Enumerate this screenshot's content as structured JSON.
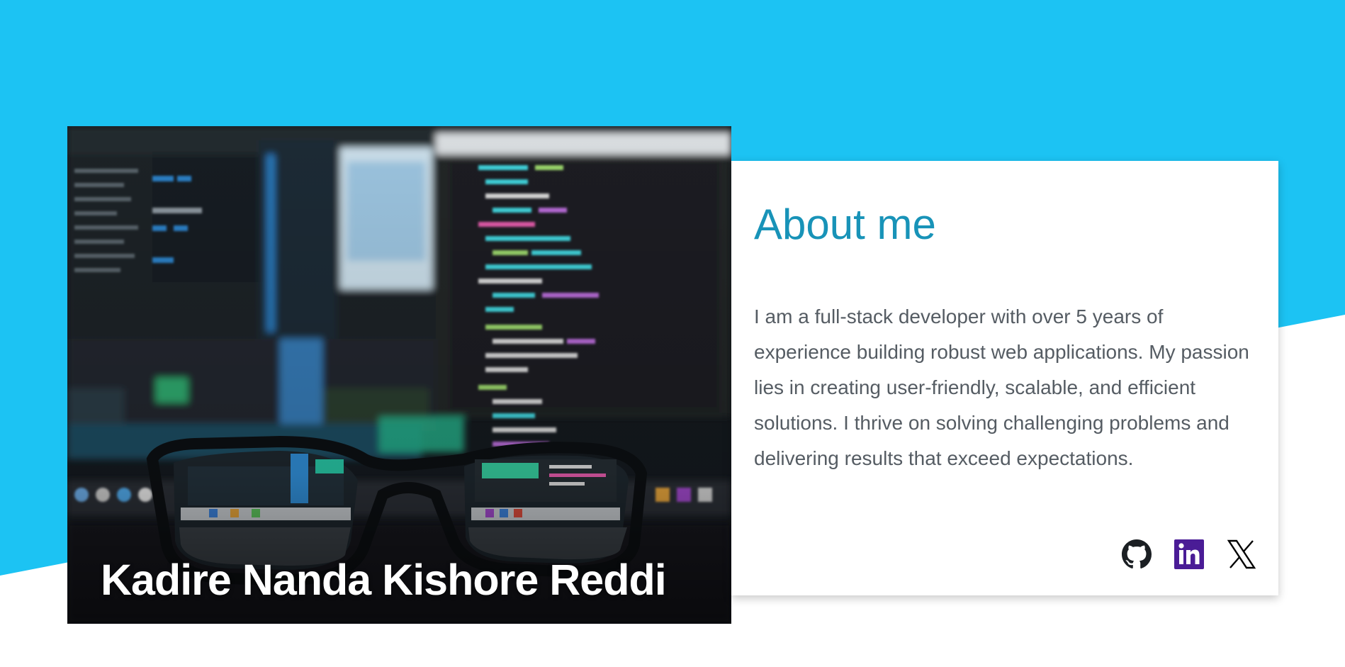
{
  "hero": {
    "name": "Kadire Nanda Kishore Reddi"
  },
  "about": {
    "title": "About me",
    "bio": "I am a full-stack developer with over 5 years of experience building robust web applications. My passion lies in creating user-friendly, scalable, and efficient solutions. I thrive on solving challenging problems and delivering results that exceed expectations."
  },
  "socials": [
    {
      "icon": "github-icon",
      "color": "#1b1f23"
    },
    {
      "icon": "linkedin-icon",
      "color": "#4a1c96"
    },
    {
      "icon": "x-icon",
      "color": "#000000"
    }
  ],
  "colors": {
    "accent": "#1cc3f3",
    "title": "#1893b8",
    "text": "#555c63"
  }
}
